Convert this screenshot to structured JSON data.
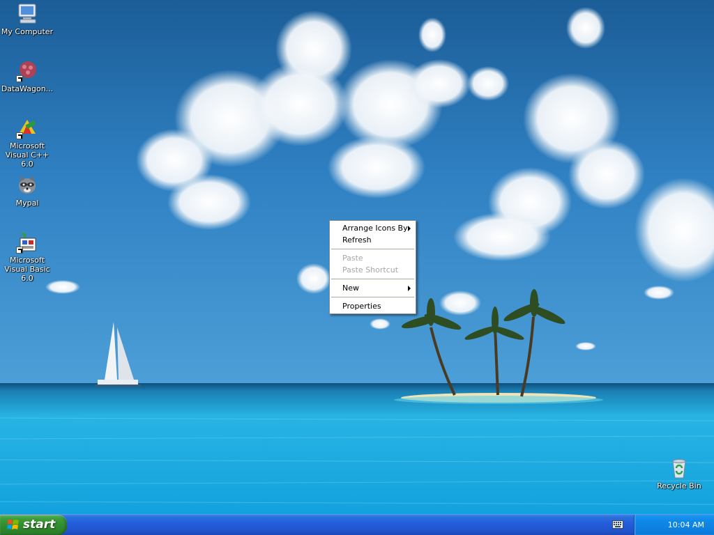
{
  "desktop": {
    "icons": [
      {
        "label": "My Computer",
        "icon": "my-computer-icon"
      },
      {
        "label": "DataWagon...",
        "icon": "datawagon-icon",
        "shortcut": true
      },
      {
        "label": "Microsoft Visual C++ 6.0",
        "icon": "visual-cpp-icon",
        "shortcut": true
      },
      {
        "label": "Mypal",
        "icon": "mypal-raccoon-icon"
      },
      {
        "label": "Microsoft Visual Basic 6.0",
        "icon": "visual-basic-icon",
        "shortcut": true
      },
      {
        "label": "Recycle Bin",
        "icon": "recycle-bin-icon"
      }
    ]
  },
  "context_menu": {
    "items": [
      {
        "label": "Arrange Icons By",
        "submenu": true,
        "enabled": true
      },
      {
        "label": "Refresh",
        "enabled": true
      },
      {
        "label": "Paste",
        "enabled": false
      },
      {
        "label": "Paste Shortcut",
        "enabled": false
      },
      {
        "label": "New",
        "submenu": true,
        "enabled": true
      },
      {
        "label": "Properties",
        "enabled": true
      }
    ]
  },
  "taskbar": {
    "start_label": "start",
    "tray_icons": [
      "keyboard-icon"
    ],
    "clock": "10:04 AM"
  },
  "colors": {
    "taskbar_blue": "#245edb",
    "start_green": "#3c9d3a",
    "tray_blue": "#0f89e8",
    "menu_disabled": "#a7a6aa"
  }
}
